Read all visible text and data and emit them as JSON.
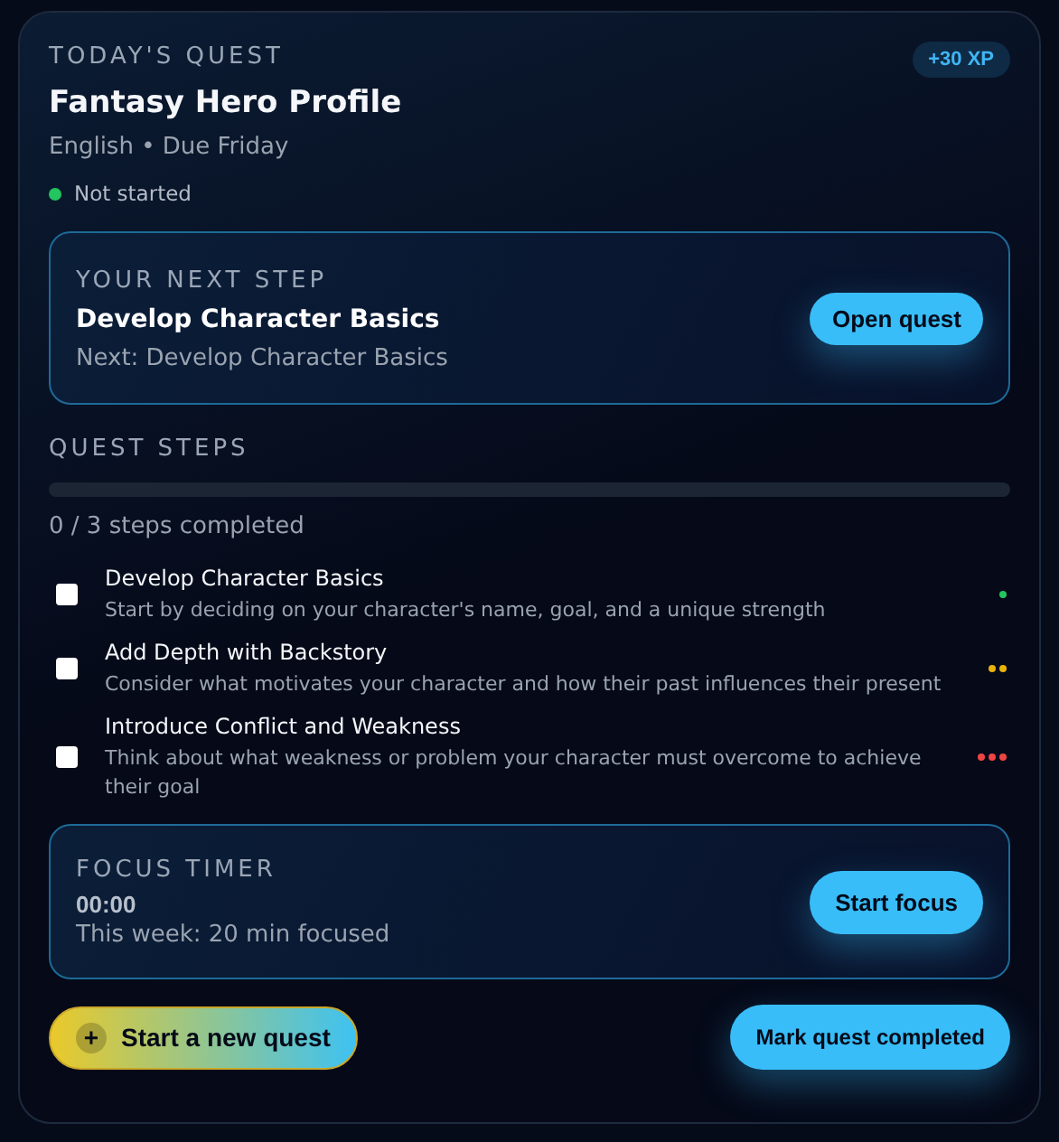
{
  "quest": {
    "eyebrow": "TODAY'S QUEST",
    "title": "Fantasy Hero Profile",
    "meta": "English • Due Friday",
    "xp": "+30 XP",
    "status": {
      "label": "Not started",
      "color": "#22c55e"
    }
  },
  "next_step": {
    "eyebrow": "YOUR NEXT STEP",
    "title": "Develop Character Basics",
    "subtitle": "Next: Develop Character Basics",
    "button": "Open quest"
  },
  "steps": {
    "heading": "QUEST STEPS",
    "progress": {
      "level": 0
    },
    "summary": "0 / 3 steps completed",
    "items": [
      {
        "title": "Develop Character Basics",
        "description": "Start by deciding on your character's name, goal, and a unique strength",
        "checked": false,
        "kind": "easy",
        "color": "#22c55e"
      },
      {
        "title": "Add Depth with Backstory",
        "description": "Consider what motivates your character and how their past influences their present",
        "checked": false,
        "kind": "medium",
        "color": "#eab308"
      },
      {
        "title": "Introduce Conflict and Weakness",
        "description": "Think about what weakness or problem your character must overcome to achieve their goal",
        "checked": false,
        "kind": "hard",
        "color": "#ef4444"
      }
    ]
  },
  "focus": {
    "eyebrow": "FOCUS TIMER",
    "time": "00:00",
    "summary": "This week: 20 min focused",
    "button": "Start focus"
  },
  "actions": {
    "new_quest": {
      "icon": "+",
      "label": "Start a new quest"
    },
    "complete": "Mark quest completed"
  }
}
